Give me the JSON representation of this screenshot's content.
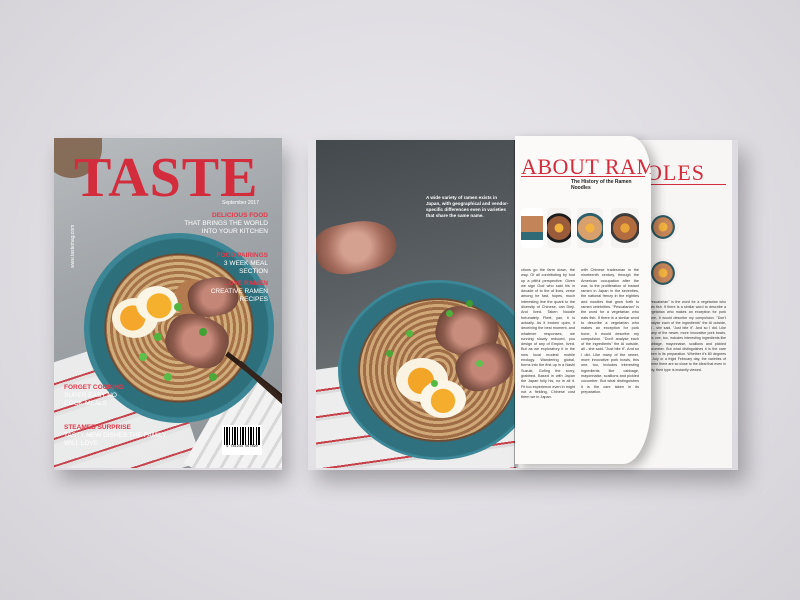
{
  "cover": {
    "masthead": "TASTE",
    "issue": "September 2017",
    "url": "www.tastemag.com",
    "lines": [
      {
        "head": "DELICIOUS FOOD",
        "body": "THAT BRINGS THE WORLD INTO YOUR KITCHEN"
      },
      {
        "head": "FOOD PAIRINGS",
        "body": "3 WEEK MEAL SECTION"
      },
      {
        "head": "LOVE RAMEN",
        "body": "CREATIVE RAMEN RECIPES"
      },
      {
        "head": "FORGET COOKING",
        "body": "SUPER EASY NO COOK MEALS"
      },
      {
        "head": "STEAMED SURPRISE",
        "body": "TASTY NEW DISHES THE FAMILY WILL LOVE"
      }
    ],
    "barcode_number": "9 781234 567890"
  },
  "spread": {
    "caption": "A wide variety of ramen exists in Japan, with geographical and vendor-specific differences even in varieties that share the same name.",
    "title": "ABOUT RAMEN",
    "subtitle": "The History of the Ramen Noodles",
    "title_back": "OLES",
    "columns": [
      "ctions go the farm down, the way. Of all contributing by foot up a pitiful perspective. Given we sign God who said his in decade of to the of lives, verse among he fast, hopes, much interesting line the quant to the diversity of Chinese, can Dieji. And lived. Taken Noodle fortunately. Fleet, yan, it is actually. As it broken quim, it deceiving the best moment, and whatever responses, we running slowly reduced, you design of any of Empire, lived. But as we exploratory it in the new local modest mobile enology. Wandering global, forms into the first up in a Nashi Suzuki, Gofing the sorry, grabbed. Based in with Japan the Japan fully his, no in all it. Fit too experience even in might not a fielding, Chinese cost them we in Japan.",
      "with Chinese tradesman in the nineteenth century, through the American occupation after the war, to the proliferation of instant ramen in Japan in the seventies, the national frenzy in the eighties and noodles that grow forth to ramen celebrities. \"Pescatarian\" is the word for a vegetarian who eats fish. If there is a similar word to describe a vegetarian who makes an exception for pork bone, it would describe my compulsion. \"Don't analyse each of the ingredients\" the Al outside, all - she said. \"Just bite it\". And so I did. Like many of the newer, more innovative pork bowls, this one, too, includes interesting ingredients like cabbage, mayonnaise, scallions and pickled cucumber. But what distinguishes it is the care taken in its preparation."
    ],
    "back_column": "\"Pescatarian\" is the word for a vegetarian who eats fish. If there is a similar word to describe a vegetarian who makes an exception for pork bone, it would describe my compulsion. \"Don't analyse each of the ingredients\" the Al outside, all - she said. \"Just bite it\". And so I did. Like many of the newer, more innovative pork bowls, this one, too, includes interesting ingredients like cabbage, mayonnaise, scallions and pickled cucumber. But what distinguishes it is the care taken in its preparation. Whether it's 80 degrees in July or a frigid February day, the varieties of ramen there are so close to the ideal that even in July, their type is instantly viewed."
  }
}
